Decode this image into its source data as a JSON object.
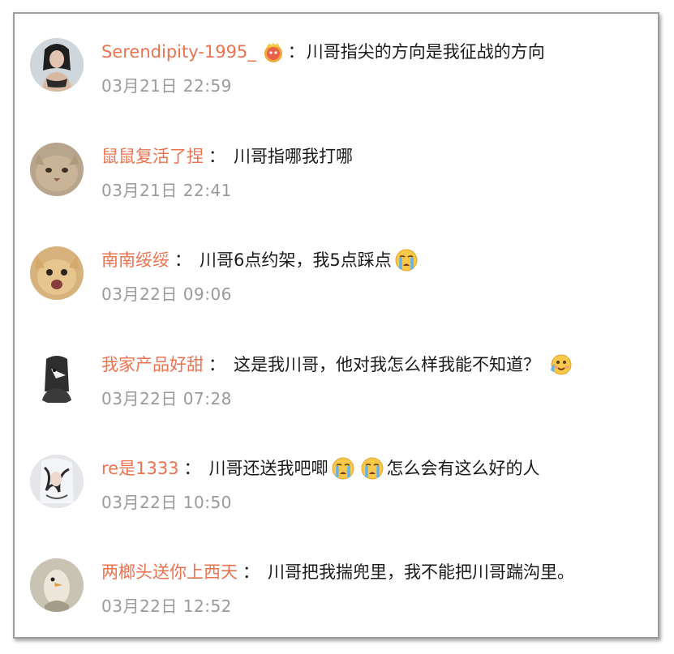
{
  "comments": [
    {
      "user": "Serendipity-1995_",
      "badge_icon": "crown-badge-icon",
      "text": "川哥指尖的方向是我征战的方向",
      "time": "03月21日 22:59"
    },
    {
      "user": "鼠鼠复活了捏",
      "text": "川哥指哪我打哪",
      "time": "03月21日 22:41"
    },
    {
      "user": "南南绥绥",
      "text": "川哥6点约架，我5点踩点",
      "emoji": "crying-face-icon",
      "time": "03月22日 09:06"
    },
    {
      "user": "我家产品好甜",
      "text": "这是我川哥，他对我怎么样我能不知道？",
      "emoji": "smirking-face-icon",
      "time": "03月22日 07:28"
    },
    {
      "user": "re是1333",
      "text_before": "川哥还送我吧唧",
      "emoji": "crying-face-icon",
      "text_after": "怎么会有这么好的人",
      "time": "03月22日 10:50"
    },
    {
      "user": "两榔头送你上西天",
      "text": "川哥把我揣兜里，我不能把川哥踹沟里。",
      "time": "03月22日 12:52"
    }
  ],
  "separator": "：",
  "colors": {
    "username": "#eb7350",
    "text": "#1a1a1a",
    "timestamp": "#9a9a9a",
    "frame_border": "#9e9e9e"
  }
}
